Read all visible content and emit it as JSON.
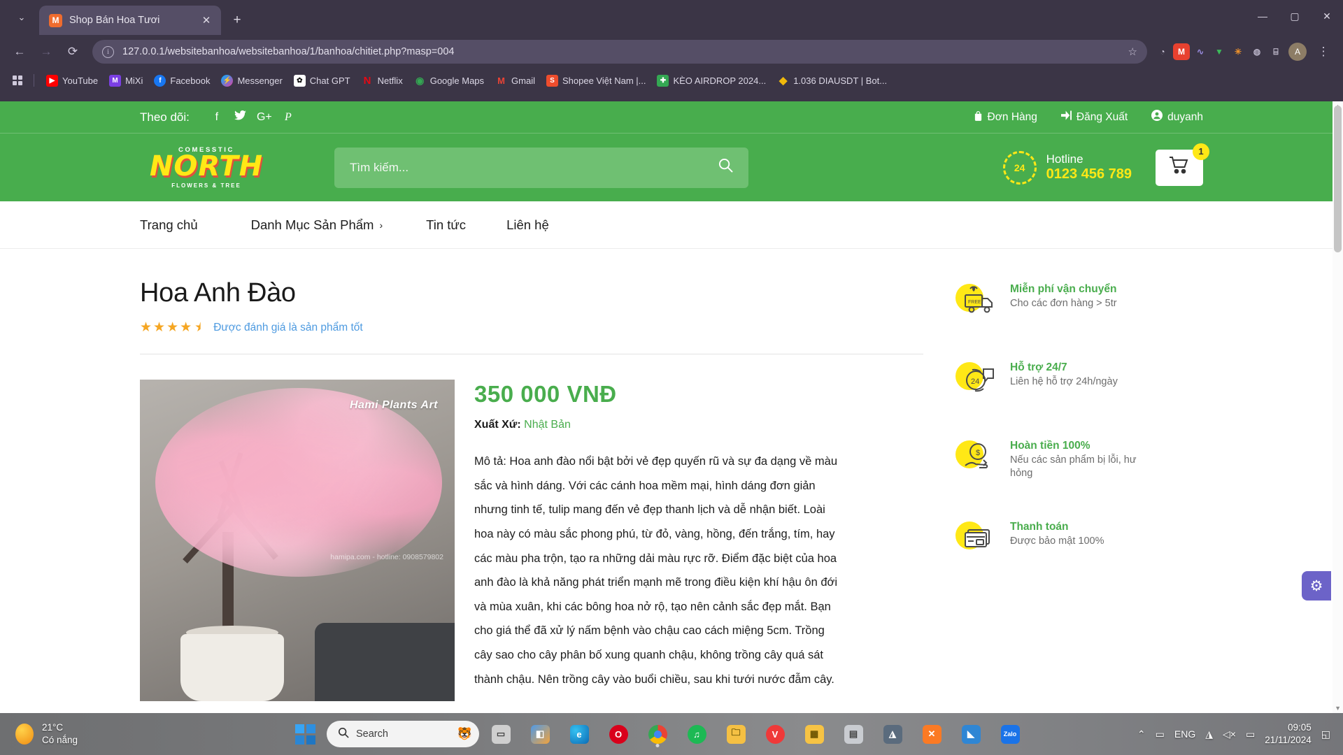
{
  "browser": {
    "tab": {
      "title": "Shop Bán Hoa Tươi",
      "favicon_label": "M",
      "close_label": "✕"
    },
    "new_tab_label": "+",
    "tabstrip_chevron": "⌄",
    "window_controls": {
      "minimize": "—",
      "maximize": "▢",
      "close": "✕"
    },
    "nav": {
      "back": "←",
      "forward": "→",
      "reload": "⟳"
    },
    "omnibox": {
      "info_icon": "i",
      "url": "127.0.0.1/websitebanhoa/websitebanhoa/1/banhoa/chitiet.php?masp=004",
      "star_icon": "☆"
    },
    "extensions": [
      {
        "name": "extension-1",
        "glyph": "◔",
        "color": "#4b4458"
      },
      {
        "name": "extension-2",
        "glyph": "M",
        "color": "#e8412f"
      },
      {
        "name": "extension-3",
        "glyph": "N",
        "color": "#4b4458"
      },
      {
        "name": "extension-4",
        "glyph": "✓",
        "color": "#3cbb5a"
      },
      {
        "name": "extension-5",
        "glyph": "✳",
        "color": "#f0932b"
      },
      {
        "name": "extension-6",
        "glyph": "◉",
        "color": "#8a66d8"
      },
      {
        "name": "extension-7",
        "glyph": "⌸",
        "color": "#4b4458"
      }
    ],
    "profile_initial": "A",
    "menu_icon": "⋮",
    "bookmarks": [
      {
        "label": "YouTube",
        "glyph": "▶",
        "color": "#ff0000"
      },
      {
        "label": "MiXi",
        "glyph": "M",
        "color": "#7b3fe4"
      },
      {
        "label": "Facebook",
        "glyph": "f",
        "color": "#1877f2"
      },
      {
        "label": "Messenger",
        "glyph": "⚡",
        "color": "#e040a0"
      },
      {
        "label": "Chat GPT",
        "glyph": "✿",
        "color": "#ffffff"
      },
      {
        "label": "Netflix",
        "glyph": "N",
        "color": "#e50914"
      },
      {
        "label": "Google Maps",
        "glyph": "◉",
        "color": "#34a853"
      },
      {
        "label": "Gmail",
        "glyph": "M",
        "color": "#ea4335"
      },
      {
        "label": "Shopee Việt Nam |...",
        "glyph": "S",
        "color": "#ee4d2d"
      },
      {
        "label": "KÈO AIRDROP 2024...",
        "glyph": "✚",
        "color": "#34a853"
      },
      {
        "label": "1.036 DIAUSDT | Bot...",
        "glyph": "◆",
        "color": "#f0b90b"
      }
    ]
  },
  "site": {
    "topbar": {
      "follow_label": "Theo dõi:",
      "social": [
        {
          "name": "facebook-icon",
          "glyph": "f"
        },
        {
          "name": "twitter-icon",
          "glyph": "🐦"
        },
        {
          "name": "google-plus-icon",
          "glyph": "G+"
        },
        {
          "name": "pinterest-icon",
          "glyph": "P"
        }
      ],
      "links": [
        {
          "label": "Đơn Hàng",
          "icon": "bag-icon",
          "glyph": "🛍"
        },
        {
          "label": "Đăng Xuất",
          "icon": "logout-icon",
          "glyph": "➜]"
        },
        {
          "label": "duyanh",
          "icon": "user-icon",
          "glyph": "◉"
        }
      ]
    },
    "logo": {
      "arc": "COMESSTIC",
      "main": "NORTH",
      "sub": "FLOWERS & TREE"
    },
    "search": {
      "placeholder": "Tìm kiếm...",
      "icon": "search-icon"
    },
    "hotline": {
      "badge": "24",
      "label": "Hotline",
      "number": "0123 456 789"
    },
    "cart": {
      "icon": "cart-icon",
      "count": "1"
    },
    "nav": [
      {
        "label": "Trang chủ",
        "chevron": ""
      },
      {
        "label": "Danh Mục Sản Phẩm",
        "chevron": "›"
      },
      {
        "label": "Tin tức",
        "chevron": ""
      },
      {
        "label": "Liên hệ",
        "chevron": ""
      }
    ]
  },
  "product": {
    "title": "Hoa Anh Đào",
    "stars": "★★★★",
    "half_star": "★",
    "rating_text": "Được đánh giá là sản phẩm tốt",
    "price": "350 000 VNĐ",
    "origin_label": "Xuất Xứ:",
    "origin_value": "Nhật Bản",
    "description": "Mô tả: Hoa anh đào nổi bật bởi vẻ đẹp quyến rũ và sự đa dạng về màu sắc và hình dáng. Với các cánh hoa mềm mại, hình dáng đơn giản nhưng tinh tế, tulip mang đến vẻ đẹp thanh lịch và dễ nhận biết. Loài hoa này có màu sắc phong phú, từ đỏ, vàng, hồng, đến trắng, tím, hay các màu pha trộn, tạo ra những dải màu rực rỡ. Điểm đặc biệt của hoa anh đào là khả năng phát triển mạnh mẽ trong điều kiện khí hậu ôn đới và mùa xuân, khi các bông hoa nở rộ, tạo nên cảnh sắc đẹp mắt. Bạn cho giá thể đã xử lý nấm bệnh vào chậu cao cách miệng 5cm. Trồng cây sao cho cây phân bố xung quanh chậu, không trồng cây quá sát thành chậu. Nên trồng cây vào buổi chiều, sau khi tưới nước đẫm cây.",
    "image": {
      "watermark_top": "Hami Plants Art",
      "watermark_bottom": "hamipa.com - hotline: 0908579802"
    }
  },
  "features": [
    {
      "icon": "free-shipping-icon",
      "title": "Miễn phí vận chuyển",
      "sub": "Cho các đơn hàng > 5tr"
    },
    {
      "icon": "support-24-7-icon",
      "title": "Hỗ trợ 24/7",
      "sub": "Liên hệ hỗ trợ 24h/ngày"
    },
    {
      "icon": "refund-icon",
      "title": "Hoàn tiền 100%",
      "sub": "Nếu các sản phẩm bị lỗi, hư hỏng"
    },
    {
      "icon": "payment-card-icon",
      "title": "Thanh toán",
      "sub": "Được bảo mật 100%"
    }
  ],
  "fab": {
    "icon": "gear-icon",
    "glyph": "⚙"
  },
  "taskbar": {
    "weather": {
      "temp": "21°C",
      "condition": "Có nắng"
    },
    "search": {
      "icon": "search-icon",
      "placeholder": "Search"
    },
    "apps": [
      {
        "name": "task-view",
        "glyph": "▭",
        "color": "#cfcfcf"
      },
      {
        "name": "widgets",
        "glyph": "◧",
        "color": "#4e9ae8"
      },
      {
        "name": "edge",
        "glyph": "e",
        "color": "#1f8fd0"
      },
      {
        "name": "opera-gx",
        "glyph": "O",
        "color": "#d9001b"
      },
      {
        "name": "chrome",
        "glyph": "◉",
        "color": "#4285f4",
        "active": true
      },
      {
        "name": "spotify",
        "glyph": "♫",
        "color": "#1db954"
      },
      {
        "name": "file-explorer",
        "glyph": "🗀",
        "color": "#ffc107"
      },
      {
        "name": "vivaldi",
        "glyph": "V",
        "color": "#ef3939"
      },
      {
        "name": "notes-app",
        "glyph": "▦",
        "color": "#f6c344"
      },
      {
        "name": "app-misc",
        "glyph": "▤",
        "color": "#b0b0b0"
      },
      {
        "name": "audio-app",
        "glyph": "◮",
        "color": "#5a6b7d"
      },
      {
        "name": "xampp",
        "glyph": "✕",
        "color": "#fb7a24"
      },
      {
        "name": "vscode",
        "glyph": "◣",
        "color": "#2f86d4"
      },
      {
        "name": "zalo",
        "glyph": "Zalo",
        "color": "#1a73e8"
      }
    ],
    "tray": {
      "chevron": "⌃",
      "display": "▭",
      "lang": "ENG",
      "wifi": "◮",
      "volume": "◁×",
      "battery": "▭"
    },
    "clock": {
      "time": "09:05",
      "date": "21/11/2024"
    },
    "notification": "◱"
  }
}
